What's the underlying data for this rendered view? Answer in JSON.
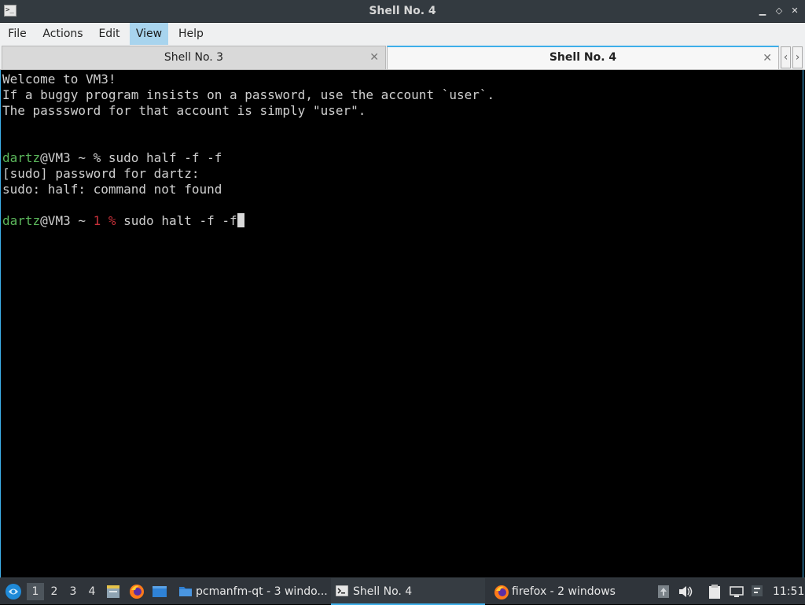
{
  "window": {
    "title": "Shell No. 4",
    "app_icon_text": ">_",
    "controls": {
      "minimize": "▁",
      "maximize": "◇",
      "close": "✕"
    }
  },
  "menu": {
    "items": [
      "File",
      "Actions",
      "Edit",
      "View",
      "Help"
    ],
    "active": "View"
  },
  "tabs": [
    {
      "label": "Shell No. 3",
      "active": false
    },
    {
      "label": "Shell No. 4",
      "active": true
    }
  ],
  "tab_nav": {
    "left": "‹",
    "right": "›"
  },
  "terminal": {
    "motd": [
      "Welcome to VM3!",
      "If a buggy program insists on a password, use the account `user`.",
      "The passsword for that account is simply \"user\"."
    ],
    "session": [
      {
        "user": "dartz",
        "host_path": "@VM3 ~ ",
        "prompt": "% ",
        "command": "sudo half -f -f"
      },
      {
        "output": "[sudo] password for dartz:"
      },
      {
        "output": "sudo: half: command not found"
      },
      {
        "user": "dartz",
        "host_path": "@VM3 ~ ",
        "status": "1 %",
        "command": " sudo halt -f -f"
      }
    ]
  },
  "taskbar": {
    "desktops": [
      "1",
      "2",
      "3",
      "4"
    ],
    "current_desktop": "1",
    "tasks": [
      {
        "label": "pcmanfm-qt - 3 windo...",
        "icon": "folder-icon",
        "active": false
      },
      {
        "label": "Shell No. 4",
        "icon": "terminal-icon",
        "active": true
      },
      {
        "label": "firefox - 2 windows",
        "icon": "firefox-icon",
        "active": false
      }
    ],
    "clock": "11:51"
  },
  "colors": {
    "accent": "#3daee9",
    "prompt_user": "#5cb85c",
    "prompt_error": "#c8313a",
    "terminal_bg": "#000000",
    "terminal_fg": "#cfcfcf"
  }
}
